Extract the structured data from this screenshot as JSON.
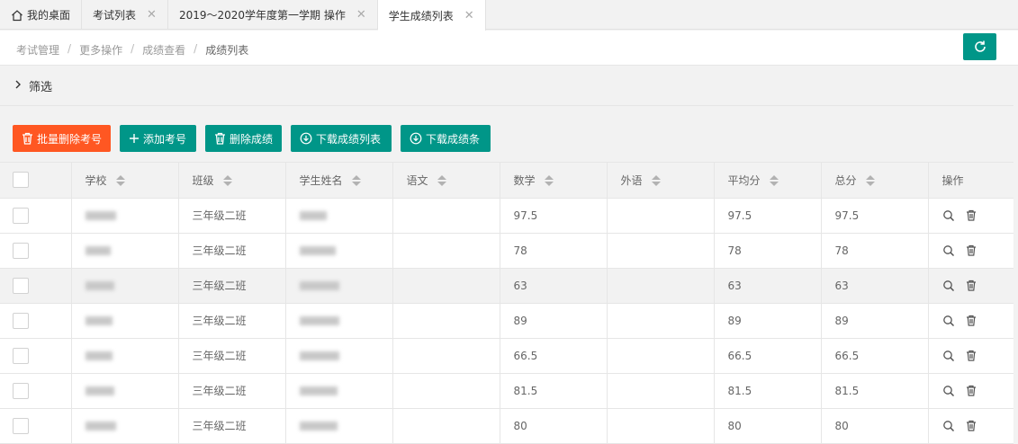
{
  "tabs": [
    {
      "label": "我的桌面",
      "home": true,
      "closable": false,
      "active": false
    },
    {
      "label": "考试列表",
      "home": false,
      "closable": true,
      "active": false
    },
    {
      "label": "2019～2020学年度第一学期 操作",
      "home": false,
      "closable": true,
      "active": false
    },
    {
      "label": "学生成绩列表",
      "home": false,
      "closable": true,
      "active": true
    }
  ],
  "breadcrumb": [
    "考试管理",
    "更多操作",
    "成绩查看",
    "成绩列表"
  ],
  "breadcrumb_sep": "/",
  "filter": {
    "label": "筛选"
  },
  "buttons": {
    "batch_delete": "批量删除考号",
    "add_exam_no": "添加考号",
    "delete_scores": "删除成绩",
    "download_list": "下载成绩列表",
    "download_slips": "下载成绩条"
  },
  "table": {
    "headers": [
      "学校",
      "班级",
      "学生姓名",
      "语文",
      "数学",
      "外语",
      "平均分",
      "总分",
      "操作"
    ],
    "rows": [
      {
        "class": "三年级二班",
        "chinese": "",
        "math": "97.5",
        "english": "",
        "average": "97.5",
        "total": "97.5"
      },
      {
        "class": "三年级二班",
        "chinese": "",
        "math": "78",
        "english": "",
        "average": "78",
        "total": "78"
      },
      {
        "class": "三年级二班",
        "chinese": "",
        "math": "63",
        "english": "",
        "average": "63",
        "total": "63"
      },
      {
        "class": "三年级二班",
        "chinese": "",
        "math": "89",
        "english": "",
        "average": "89",
        "total": "89"
      },
      {
        "class": "三年级二班",
        "chinese": "",
        "math": "66.5",
        "english": "",
        "average": "66.5",
        "total": "66.5"
      },
      {
        "class": "三年级二班",
        "chinese": "",
        "math": "81.5",
        "english": "",
        "average": "81.5",
        "total": "81.5"
      },
      {
        "class": "三年级二班",
        "chinese": "",
        "math": "80",
        "english": "",
        "average": "80",
        "total": "80"
      }
    ],
    "highlighted_row": 2
  },
  "colors": {
    "primary": "#009688",
    "danger": "#ff5722",
    "bg": "#f2f2f2"
  },
  "icons": {
    "home": "home-icon",
    "close": "close-icon",
    "refresh": "refresh-icon",
    "view": "search-icon",
    "delete": "trash-icon",
    "download": "download-circle-icon",
    "add": "plus-icon"
  }
}
